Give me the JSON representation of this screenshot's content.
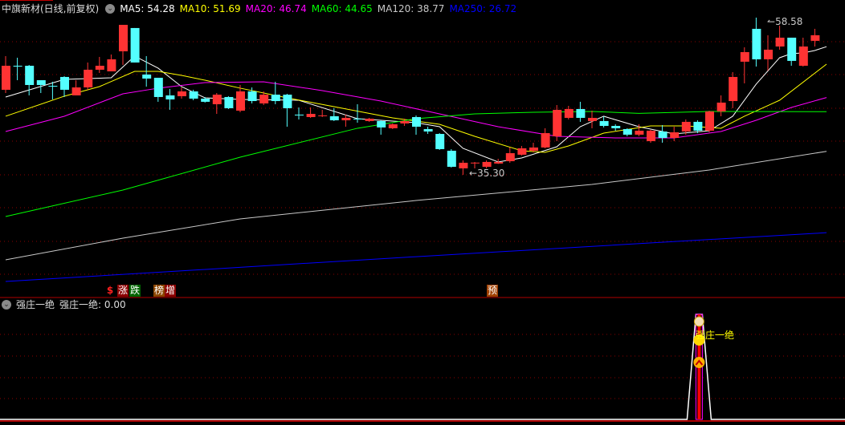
{
  "header": {
    "title": "中旗新材(日线,前复权)",
    "ma": [
      {
        "label": "MA5: 54.28",
        "color": "#ffffff"
      },
      {
        "label": "MA10: 51.69",
        "color": "#ffff00"
      },
      {
        "label": "MA20: 46.74",
        "color": "#ff00ff"
      },
      {
        "label": "MA60: 44.65",
        "color": "#00ff00"
      },
      {
        "label": "MA120: 38.77",
        "color": "#c8c8c8"
      },
      {
        "label": "MA250: 26.72",
        "color": "#0000ff"
      }
    ]
  },
  "signals": {
    "dollar": "$",
    "rise": "涨",
    "fall": "跌",
    "list": "榜",
    "increase": "增",
    "forecast": "预"
  },
  "sub_panel": {
    "name": "强庄一绝",
    "value_label": "强庄一绝: 0.00",
    "signal_text": "强庄一绝"
  },
  "colors": {
    "up": "#ff3333",
    "down": "#54ffff",
    "grid": "#8b0000",
    "separator": "#b00000"
  },
  "chart_data": {
    "type": "candlestick",
    "ylim": [
      19.02,
      61.19
    ],
    "annotations": {
      "high": {
        "index": 64,
        "label": "58.58"
      },
      "low": {
        "index": 39,
        "label": "35.30"
      }
    },
    "ohlc": [
      [
        47.89,
        52.88,
        47.41,
        51.45
      ],
      [
        51.45,
        52.64,
        49.31,
        51.44
      ],
      [
        51.45,
        51.57,
        47.06,
        48.6
      ],
      [
        49.31,
        49.31,
        47.41,
        48.6
      ],
      [
        48.48,
        49.08,
        46.46,
        48.47
      ],
      [
        49.79,
        49.91,
        46.82,
        47.89
      ],
      [
        47.06,
        49.31,
        47.06,
        48.24
      ],
      [
        48.24,
        51.93,
        47.89,
        50.86
      ],
      [
        50.86,
        52.76,
        50.38,
        51.45
      ],
      [
        50.62,
        53.12,
        50.62,
        52.4
      ],
      [
        53.59,
        57.51,
        51.57,
        57.51
      ],
      [
        57.04,
        57.04,
        51.93,
        51.93
      ],
      [
        50.15,
        52.88,
        48.36,
        49.55
      ],
      [
        49.67,
        49.67,
        46.11,
        46.82
      ],
      [
        47.06,
        48.01,
        44.92,
        46.46
      ],
      [
        46.94,
        48.24,
        46.58,
        47.65
      ],
      [
        47.65,
        47.89,
        46.34,
        46.58
      ],
      [
        46.58,
        46.82,
        45.99,
        46.11
      ],
      [
        45.75,
        47.41,
        44.32,
        47.17
      ],
      [
        46.82,
        46.94,
        45.04,
        45.16
      ],
      [
        44.8,
        48.6,
        44.56,
        47.65
      ],
      [
        47.65,
        48.24,
        45.87,
        46.22
      ],
      [
        45.87,
        47.65,
        45.63,
        47.17
      ],
      [
        47.17,
        49.08,
        45.75,
        46.22
      ],
      [
        47.17,
        47.29,
        42.42,
        45.16
      ],
      [
        44.21,
        45.27,
        43.49,
        44.2
      ],
      [
        43.85,
        45.27,
        43.73,
        44.32
      ],
      [
        44.09,
        44.92,
        43.85,
        44.1
      ],
      [
        43.97,
        45.16,
        43.26,
        43.37
      ],
      [
        43.37,
        44.21,
        42.42,
        43.73
      ],
      [
        43.61,
        45.75,
        43.02,
        43.6
      ],
      [
        43.26,
        43.73,
        43.14,
        43.61
      ],
      [
        43.26,
        43.37,
        41.24,
        42.31
      ],
      [
        42.19,
        42.9,
        42.07,
        42.78
      ],
      [
        42.9,
        43.61,
        42.54,
        43.26
      ],
      [
        43.85,
        44.09,
        41.24,
        42.42
      ],
      [
        42.07,
        42.42,
        41.35,
        41.71
      ],
      [
        41.35,
        41.47,
        38.98,
        39.1
      ],
      [
        38.86,
        39.1,
        36.37,
        36.48
      ],
      [
        36.25,
        37.43,
        35.3,
        37.08
      ],
      [
        37.08,
        37.2,
        36.25,
        37.1
      ],
      [
        36.48,
        37.43,
        36.25,
        37.2
      ],
      [
        36.96,
        37.67,
        36.9,
        37.2
      ],
      [
        37.31,
        39.34,
        37.08,
        38.5
      ],
      [
        38.27,
        39.57,
        38.15,
        39.22
      ],
      [
        38.86,
        40.05,
        38.62,
        39.34
      ],
      [
        39.34,
        42.19,
        39.22,
        41.47
      ],
      [
        41.0,
        45.63,
        40.28,
        44.92
      ],
      [
        43.73,
        45.51,
        43.49,
        45.04
      ],
      [
        45.04,
        46.11,
        43.14,
        43.73
      ],
      [
        43.26,
        44.8,
        42.19,
        43.73
      ],
      [
        43.26,
        43.97,
        42.31,
        42.54
      ],
      [
        42.54,
        42.78,
        41.83,
        42.19
      ],
      [
        42.07,
        42.19,
        41.0,
        41.24
      ],
      [
        41.24,
        42.78,
        41.0,
        41.83
      ],
      [
        40.28,
        41.95,
        40.05,
        41.83
      ],
      [
        41.71,
        42.66,
        40.05,
        40.76
      ],
      [
        40.76,
        42.42,
        40.28,
        41.59
      ],
      [
        41.71,
        43.49,
        41.24,
        43.14
      ],
      [
        43.14,
        43.37,
        41.47,
        41.83
      ],
      [
        41.83,
        44.8,
        41.59,
        44.68
      ],
      [
        44.68,
        47.06,
        43.97,
        45.99
      ],
      [
        46.22,
        50.5,
        45.16,
        49.79
      ],
      [
        52.05,
        54.18,
        48.84,
        53.47
      ],
      [
        56.92,
        58.58,
        51.33,
        52.4
      ],
      [
        52.4,
        55.97,
        50.74,
        53.83
      ],
      [
        54.3,
        57.39,
        53.83,
        55.61
      ],
      [
        55.61,
        55.61,
        51.45,
        52.17
      ],
      [
        51.45,
        55.61,
        51.33,
        54.3
      ],
      [
        55.14,
        56.92,
        54.3,
        55.97
      ]
    ],
    "ma_series": [
      {
        "name": "MA5",
        "color": "#ffffff",
        "points": [
          [
            0,
            46.82
          ],
          [
            5,
            49.43
          ],
          [
            9,
            49.67
          ],
          [
            11,
            52.88
          ],
          [
            13,
            51.1
          ],
          [
            15,
            48.36
          ],
          [
            17,
            46.7
          ],
          [
            20,
            46.46
          ],
          [
            25,
            46.34
          ],
          [
            30,
            43.61
          ],
          [
            35,
            43.02
          ],
          [
            37,
            42.42
          ],
          [
            39,
            39.22
          ],
          [
            42,
            37.2
          ],
          [
            44,
            37.79
          ],
          [
            47,
            39.45
          ],
          [
            49,
            42.42
          ],
          [
            51,
            43.97
          ],
          [
            54,
            42.42
          ],
          [
            57,
            41.35
          ],
          [
            60,
            41.83
          ],
          [
            62,
            43.97
          ],
          [
            64,
            48.72
          ],
          [
            66,
            52.64
          ],
          [
            67,
            53.24
          ],
          [
            68,
            53.35
          ],
          [
            69,
            53.71
          ],
          [
            70,
            54.28
          ]
        ]
      },
      {
        "name": "MA10",
        "color": "#ffff00",
        "points": [
          [
            0,
            43.97
          ],
          [
            5,
            46.94
          ],
          [
            8,
            48.36
          ],
          [
            11,
            50.62
          ],
          [
            13,
            50.62
          ],
          [
            15,
            50.03
          ],
          [
            17,
            49.31
          ],
          [
            20,
            48.13
          ],
          [
            24,
            46.7
          ],
          [
            28,
            45.39
          ],
          [
            33,
            43.73
          ],
          [
            37,
            42.78
          ],
          [
            40,
            41.0
          ],
          [
            44,
            38.86
          ],
          [
            46,
            38.62
          ],
          [
            48,
            39.57
          ],
          [
            51,
            41.47
          ],
          [
            55,
            42.54
          ],
          [
            58,
            42.54
          ],
          [
            61,
            42.19
          ],
          [
            63,
            43.97
          ],
          [
            66,
            46.34
          ],
          [
            70,
            51.69
          ]
        ]
      },
      {
        "name": "MA20",
        "color": "#ff00ff",
        "points": [
          [
            0,
            41.71
          ],
          [
            5,
            43.97
          ],
          [
            10,
            47.29
          ],
          [
            13,
            48.13
          ],
          [
            17,
            48.96
          ],
          [
            22,
            49.08
          ],
          [
            27,
            47.77
          ],
          [
            32,
            46.22
          ],
          [
            37,
            44.32
          ],
          [
            42,
            42.42
          ],
          [
            47,
            41.0
          ],
          [
            52,
            40.76
          ],
          [
            57,
            40.76
          ],
          [
            61,
            41.71
          ],
          [
            64,
            43.37
          ],
          [
            67,
            45.27
          ],
          [
            70,
            46.74
          ]
        ]
      },
      {
        "name": "MA60",
        "color": "#00ff00",
        "points": [
          [
            0,
            29.12
          ],
          [
            10,
            33.04
          ],
          [
            20,
            37.91
          ],
          [
            30,
            42.19
          ],
          [
            35,
            43.61
          ],
          [
            40,
            44.32
          ],
          [
            45,
            44.56
          ],
          [
            50,
            44.68
          ],
          [
            54,
            44.4
          ],
          [
            60,
            44.68
          ],
          [
            70,
            44.65
          ]
        ]
      },
      {
        "name": "MA120",
        "color": "#c8c8c8",
        "points": [
          [
            0,
            22.7
          ],
          [
            10,
            25.91
          ],
          [
            20,
            28.76
          ],
          [
            35,
            31.49
          ],
          [
            50,
            33.87
          ],
          [
            60,
            36.01
          ],
          [
            70,
            38.77
          ]
        ]
      },
      {
        "name": "MA250",
        "color": "#0000ff",
        "points": [
          [
            0,
            19.49
          ],
          [
            35,
            23.17
          ],
          [
            70,
            26.72
          ]
        ]
      }
    ],
    "signal_marks": [
      {
        "index": 59,
        "value": 1
      }
    ]
  }
}
